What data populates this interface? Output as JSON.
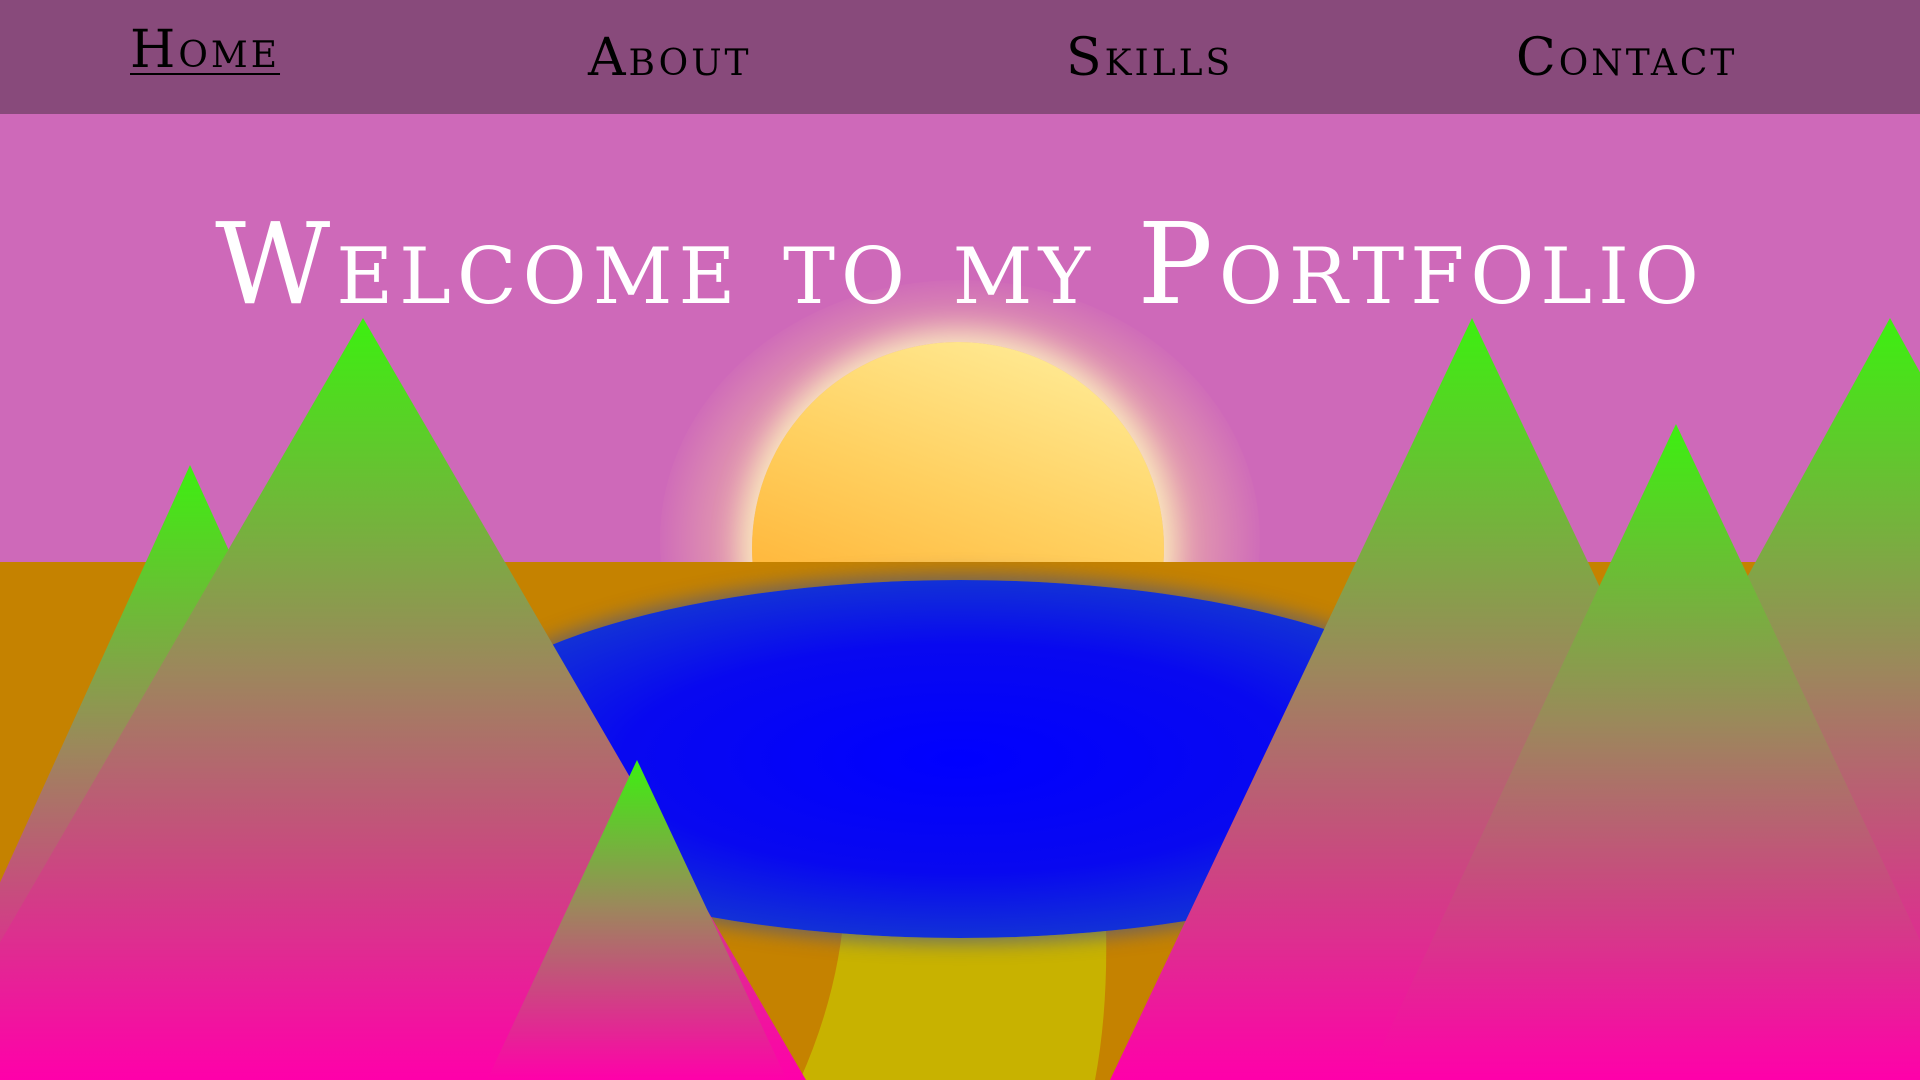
{
  "nav": {
    "items": [
      {
        "label": "Home",
        "active": true
      },
      {
        "label": "About",
        "active": false
      },
      {
        "label": "Skills",
        "active": false
      },
      {
        "label": "Contact",
        "active": false
      }
    ]
  },
  "hero": {
    "title": "Welcome to my Portfolio"
  },
  "colors": {
    "nav_background": "#884a7b",
    "sky": "#ce69b9",
    "ground": "#c58200",
    "lake": "#0000ff",
    "path": "#c8b200",
    "mountain_top": "#3cf010",
    "mountain_bottom": "#ff00aa",
    "sun": "#ffb020",
    "title_text": "#ffffff"
  }
}
